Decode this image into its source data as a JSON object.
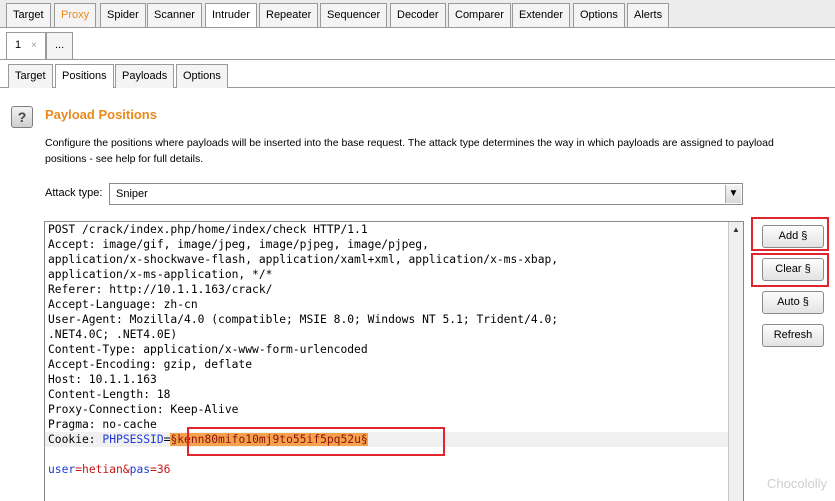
{
  "top_tabs": [
    "Target",
    "Proxy",
    "Spider",
    "Scanner",
    "Intruder",
    "Repeater",
    "Sequencer",
    "Decoder",
    "Comparer",
    "Extender",
    "Options",
    "Alerts"
  ],
  "number_tabs": {
    "first": "1",
    "close": "×",
    "more": "..."
  },
  "sub_tabs": [
    "Target",
    "Positions",
    "Payloads",
    "Options"
  ],
  "help_icon": "?",
  "section": {
    "title": "Payload Positions",
    "description_line1": "Configure the positions where payloads will be inserted into the base request. The attack type determines the way in which payloads are assigned to payload",
    "description_line2": "positions - see help for full details."
  },
  "attack_type": {
    "label": "Attack type:",
    "value": "Sniper",
    "arrow": "▼"
  },
  "request": {
    "lines": [
      "POST /crack/index.php/home/index/check HTTP/1.1",
      "Accept: image/gif, image/jpeg, image/pjpeg, image/pjpeg,",
      "application/x-shockwave-flash, application/xaml+xml, application/x-ms-xbap,",
      "application/x-ms-application, */*",
      "Referer: http://10.1.1.163/crack/",
      "Accept-Language: zh-cn",
      "User-Agent: Mozilla/4.0 (compatible; MSIE 8.0; Windows NT 5.1; Trident/4.0;",
      ".NET4.0C; .NET4.0E)",
      "Content-Type: application/x-www-form-urlencoded",
      "Accept-Encoding: gzip, deflate",
      "Host: 10.1.1.163",
      "Content-Length: 18",
      "Proxy-Connection: Keep-Alive",
      "Pragma: no-cache"
    ],
    "cookie_key": "Cookie: ",
    "cookie_name": "PHPSESSID",
    "cookie_eq": "=",
    "cookie_payload": "§kenn80mifo10mj9to55if5pq52u§",
    "body_user_key": "user",
    "body_user_val": "=hetian&",
    "body_pas_key": "pas",
    "body_pas_val": "=36"
  },
  "buttons": {
    "add": "Add §",
    "clear": "Clear §",
    "auto": "Auto §",
    "refresh": "Refresh"
  },
  "colors": {
    "accent": "#e98a1c",
    "highlight_box": "#e0262a",
    "payload_bg": "#f5a24c",
    "param_name": "#1e3bd6",
    "param_value": "#c51818"
  },
  "watermark": "Chocololly"
}
